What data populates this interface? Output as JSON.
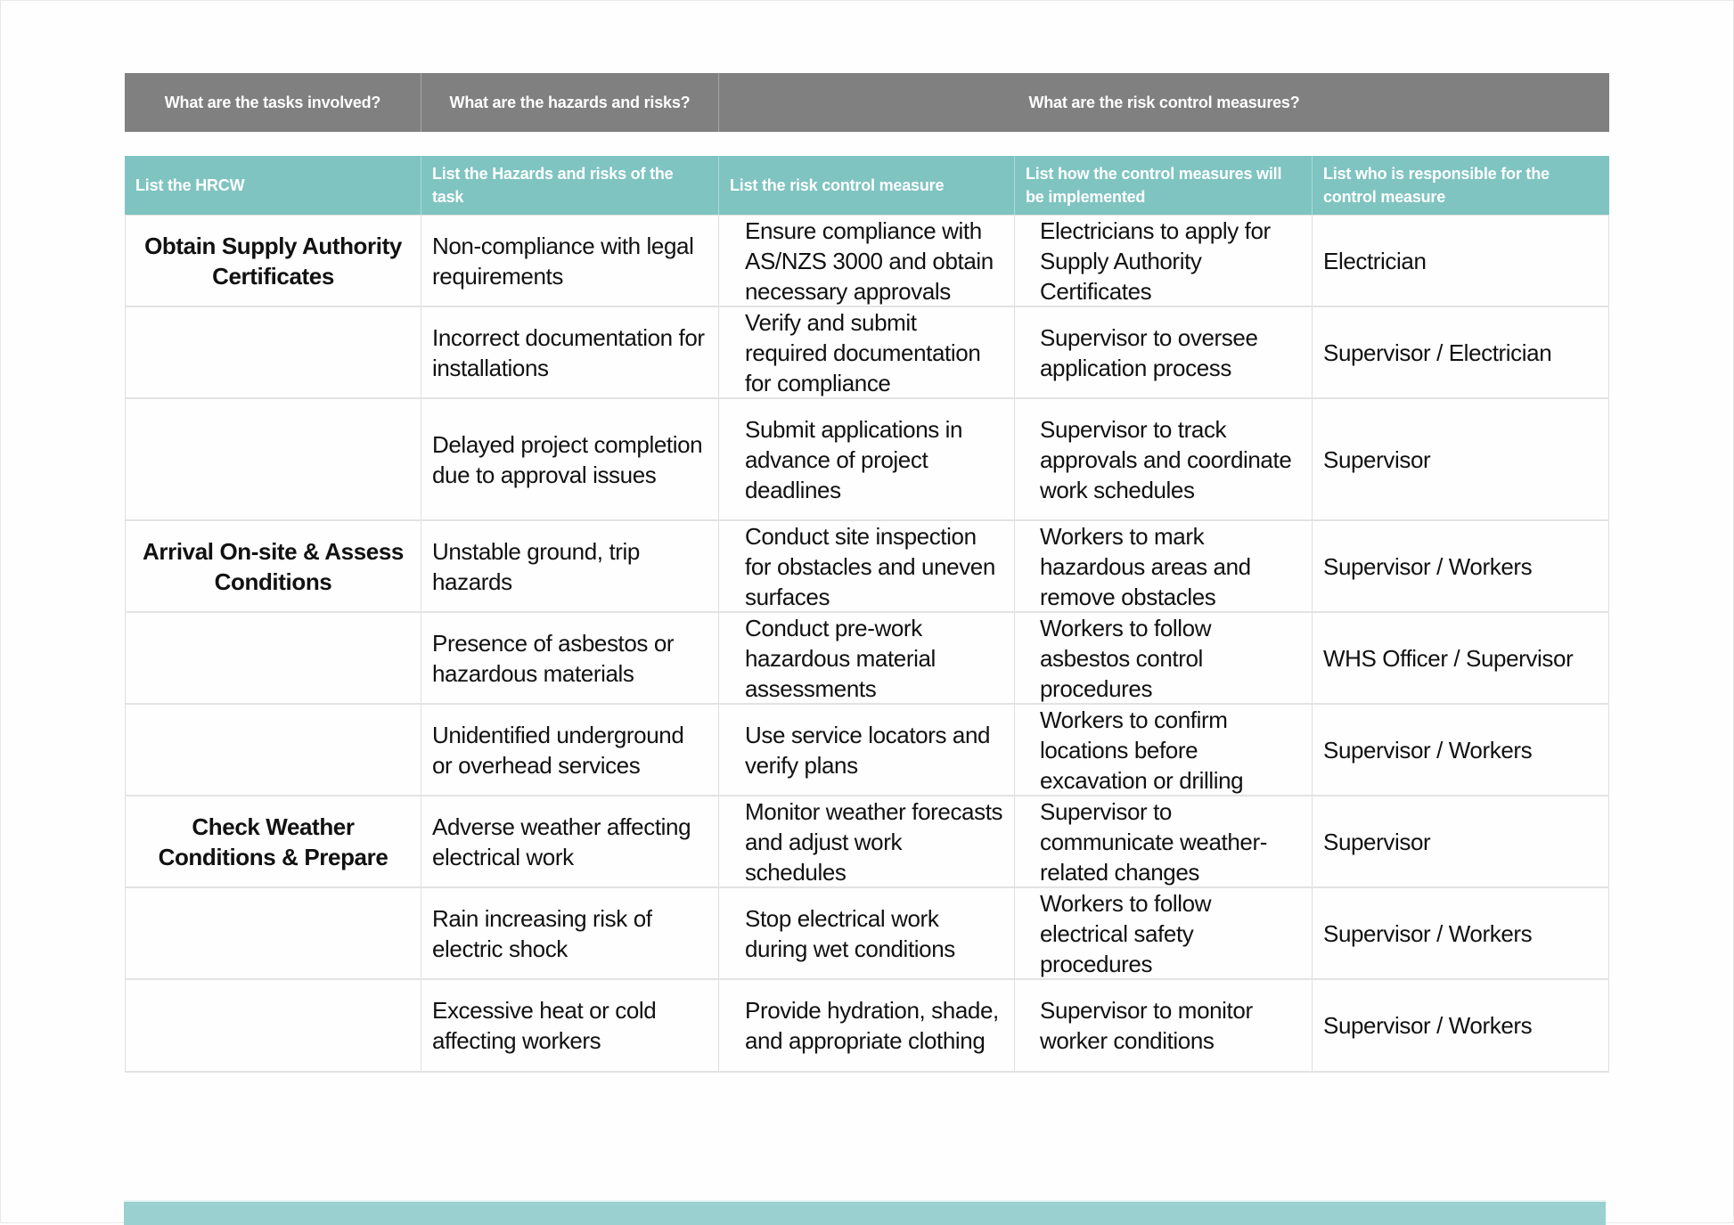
{
  "group_headers": [
    "What are the tasks involved?",
    "What are the hazards and risks?",
    "What are the risk control measures?"
  ],
  "column_headers": [
    "List the HRCW",
    "List the Hazards and risks of the task",
    "List the risk control measure",
    "List how the control measures will be implemented",
    "List who is responsible for the control measure"
  ],
  "rows": [
    {
      "task": "Obtain Supply Authority Certificates",
      "hazard": "Non-compliance with legal requirements",
      "control": "Ensure compliance with AS/NZS 3000 and obtain necessary approvals",
      "implementation": "Electricians to apply for Supply Authority Certificates",
      "responsible": "Electrician"
    },
    {
      "task": "",
      "hazard": "Incorrect documentation for installations",
      "control": "Verify and submit required documentation for compliance",
      "implementation": "Supervisor to oversee application process",
      "responsible": "Supervisor / Electrician"
    },
    {
      "task": "",
      "hazard": "Delayed project completion due to approval issues",
      "control": "Submit applications in advance of project deadlines",
      "implementation": "Supervisor to track approvals and coordinate work schedules",
      "responsible": "Supervisor"
    },
    {
      "task": "Arrival On-site & Assess Conditions",
      "hazard": "Unstable ground, trip hazards",
      "control": "Conduct site inspection for obstacles and uneven surfaces",
      "implementation": "Workers to mark hazardous areas and remove obstacles",
      "responsible": "Supervisor / Workers"
    },
    {
      "task": "",
      "hazard": "Presence of asbestos or hazardous materials",
      "control": "Conduct pre-work hazardous material assessments",
      "implementation": "Workers to follow asbestos control procedures",
      "responsible": "WHS Officer / Supervisor"
    },
    {
      "task": "",
      "hazard": "Unidentified underground or overhead services",
      "control": "Use service locators and verify plans",
      "implementation": "Workers to confirm locations before excavation or drilling",
      "responsible": "Supervisor / Workers"
    },
    {
      "task": "Check Weather Conditions & Prepare",
      "hazard": "Adverse weather affecting electrical work",
      "control": "Monitor weather forecasts and adjust work schedules",
      "implementation": "Supervisor to communicate weather-related changes",
      "responsible": "Supervisor"
    },
    {
      "task": "",
      "hazard": "Rain increasing risk of electric shock",
      "control": "Stop electrical work during wet conditions",
      "implementation": "Workers to follow electrical safety procedures",
      "responsible": "Supervisor / Workers"
    },
    {
      "task": "",
      "hazard": "Excessive heat or cold affecting workers",
      "control": "Provide hydration, shade, and appropriate clothing",
      "implementation": "Supervisor to monitor worker conditions",
      "responsible": "Supervisor / Workers"
    }
  ],
  "colors": {
    "group_header_bg": "#808080",
    "column_header_bg": "#7fc4c1",
    "footer_bar": "#9ad0cf"
  }
}
